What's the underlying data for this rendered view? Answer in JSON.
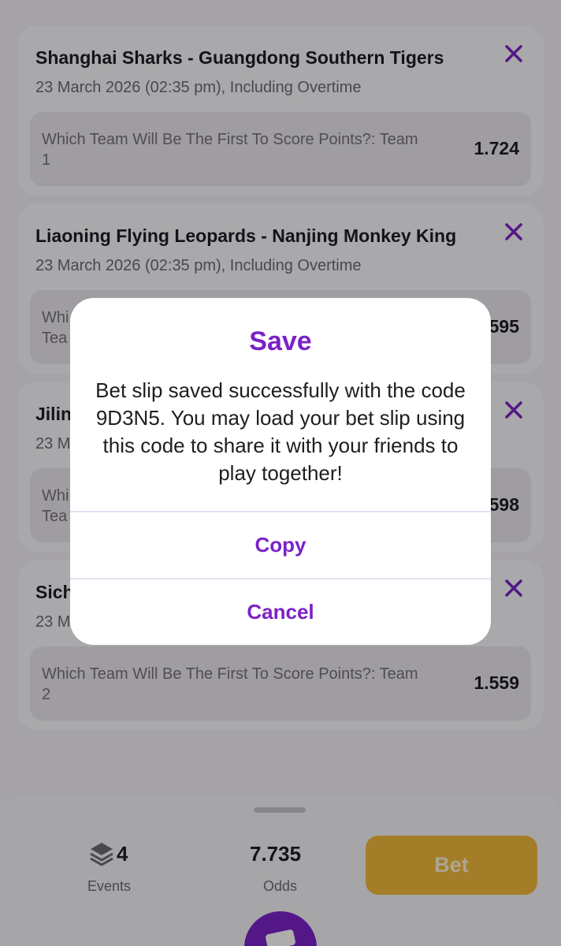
{
  "bets": [
    {
      "match": "Shanghai Sharks - Guangdong Southern Tigers",
      "date": "23 March 2026 (02:35 pm), Including Overtime",
      "selection": "Which Team Will Be The First To Score Points?: Team 1",
      "odds": "1.724"
    },
    {
      "match": "Liaoning Flying Leopards - Nanjing Monkey King",
      "date": "23 March 2026 (02:35 pm), Including Overtime",
      "selection": "Whi",
      "selection_line2": "Tea",
      "odds": "595"
    },
    {
      "match": "Jilin",
      "date": "23 M",
      "selection": "Whi",
      "selection_line2": "Tea",
      "odds": "598"
    },
    {
      "match": "Sich",
      "date": "23 M",
      "selection": "Which Team Will Be The First To Score Points?: Team 2",
      "odds": "1.559"
    }
  ],
  "footer": {
    "events_count": "4",
    "events_label": "Events",
    "odds_value": "7.735",
    "odds_label": "Odds",
    "bet_label": "Bet"
  },
  "dialog": {
    "title": "Save",
    "message": "Bet slip saved successfully with the code 9D3N5. You may load your bet slip using this code to share it with your friends to play together!",
    "copy_label": "Copy",
    "cancel_label": "Cancel"
  },
  "colors": {
    "accent": "#7b22c7",
    "bet_button": "#f2b83b"
  }
}
